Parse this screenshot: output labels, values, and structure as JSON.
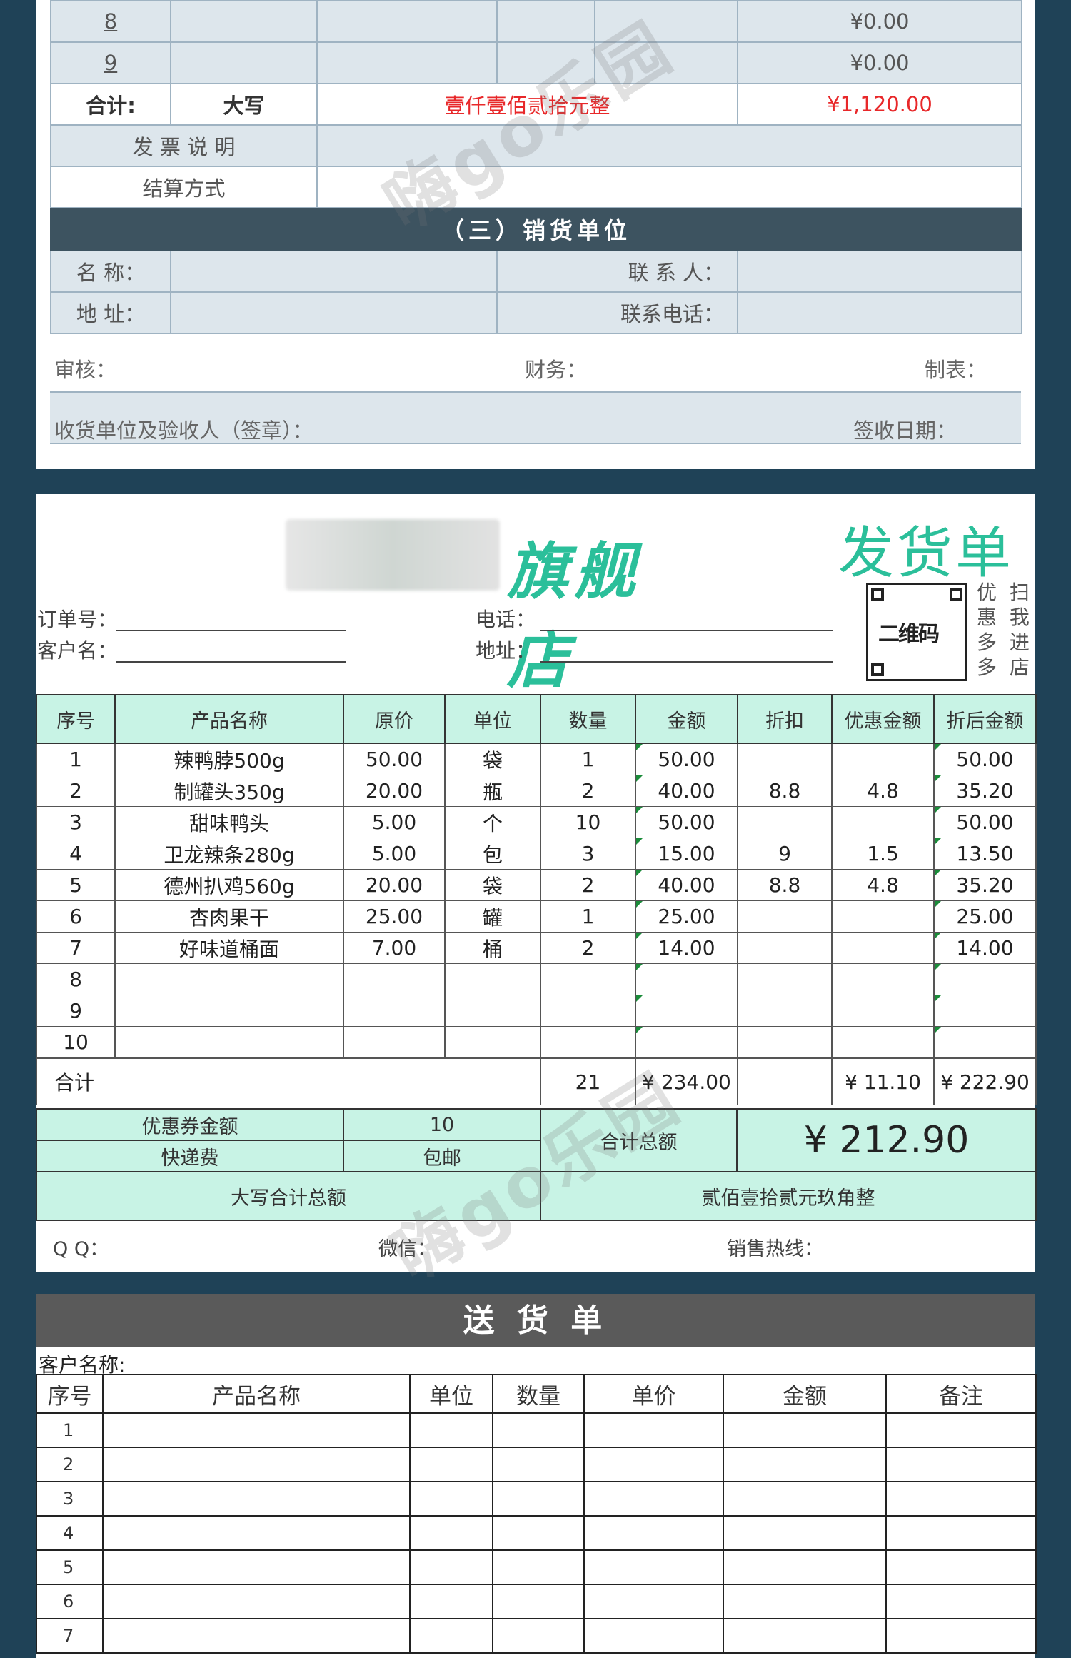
{
  "panel1": {
    "rows": [
      {
        "no": "8",
        "amount": "¥0.00"
      },
      {
        "no": "9",
        "amount": "¥0.00"
      }
    ],
    "total": {
      "label": "合计:",
      "daxie_label": "大写",
      "daxie": "壹仟壹佰贰拾元整",
      "amount": "¥1,120.00"
    },
    "invoice_label": "发 票 说 明",
    "settle_label": "结算方式",
    "section_title": "（三）销货单位",
    "name_label": "名 称：",
    "contact_label": "联 系 人：",
    "address_label": "地 址：",
    "phone_label": "联系电话：",
    "review_label": "审核：",
    "finance_label": "财务：",
    "maker_label": "制表：",
    "receiver_label": "收货单位及验收人（签章）：",
    "sign_date_label": "签收日期："
  },
  "watermark": "嗨go乐园",
  "panel2": {
    "store_name": "旗舰店",
    "title": "发货单",
    "order_label": "订单号：",
    "customer_label": "客户名：",
    "phone_label": "电话：",
    "address_label": "地址：",
    "qr_label": "二维码",
    "qr_text": [
      "优",
      "扫",
      "惠",
      "我",
      "多",
      "进",
      "多",
      "店"
    ],
    "headers": [
      "序号",
      "产品名称",
      "原价",
      "单位",
      "数量",
      "金额",
      "折扣",
      "优惠金额",
      "折后金额"
    ],
    "rows": [
      [
        "1",
        "辣鸭脖500g",
        "50.00",
        "袋",
        "1",
        "50.00",
        "",
        "",
        "50.00"
      ],
      [
        "2",
        "制罐头350g",
        "20.00",
        "瓶",
        "2",
        "40.00",
        "8.8",
        "4.8",
        "35.20"
      ],
      [
        "3",
        "甜味鸭头",
        "5.00",
        "个",
        "10",
        "50.00",
        "",
        "",
        "50.00"
      ],
      [
        "4",
        "卫龙辣条280g",
        "5.00",
        "包",
        "3",
        "15.00",
        "9",
        "1.5",
        "13.50"
      ],
      [
        "5",
        "德州扒鸡560g",
        "20.00",
        "袋",
        "2",
        "40.00",
        "8.8",
        "4.8",
        "35.20"
      ],
      [
        "6",
        "杏肉果干",
        "25.00",
        "罐",
        "1",
        "25.00",
        "",
        "",
        "25.00"
      ],
      [
        "7",
        "好味道桶面",
        "7.00",
        "桶",
        "2",
        "14.00",
        "",
        "",
        "14.00"
      ],
      [
        "8",
        "",
        "",
        "",
        "",
        "",
        "",
        "",
        ""
      ],
      [
        "9",
        "",
        "",
        "",
        "",
        "",
        "",
        "",
        ""
      ],
      [
        "10",
        "",
        "",
        "",
        "",
        "",
        "",
        "",
        ""
      ]
    ],
    "total": {
      "label": "合计",
      "qty": "21",
      "amount": "¥ 234.00",
      "discount": "¥ 11.10",
      "after": "¥ 222.90"
    },
    "coupon_label": "优惠券金额",
    "coupon_value": "10",
    "shipping_label": "快递费",
    "shipping_value": "包邮",
    "grand_label": "合计总额",
    "grand_value": "¥ 212.90",
    "daxie_label": "大写合计总额",
    "daxie_value": "贰佰壹拾贰元玖角整",
    "qq_label": "Q Q：",
    "wechat_label": "微信：",
    "hotline_label": "销售热线："
  },
  "panel3": {
    "title": "送 货 单",
    "customer_label": "客户名称:",
    "headers": [
      "序号",
      "产品名称",
      "单位",
      "数量",
      "单价",
      "金额",
      "备注"
    ],
    "rows": [
      "1",
      "2",
      "3",
      "4",
      "5",
      "6",
      "7"
    ]
  },
  "colors": {
    "background": "#1f4257",
    "accent": "#2bbf9a",
    "mint": "#c8f3e5",
    "red": "#e8282a"
  }
}
